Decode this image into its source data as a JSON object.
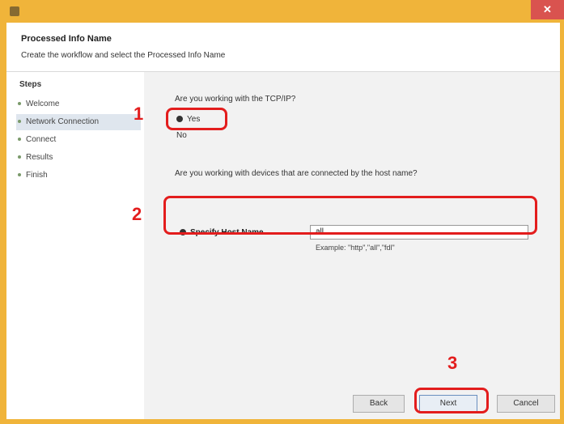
{
  "window": {
    "title": "",
    "close_label": "✕"
  },
  "header": {
    "title": "Processed Info Name",
    "description": "Create the workflow and select the Processed Info Name"
  },
  "sidebar": {
    "heading": "Steps",
    "items": [
      {
        "label": "Welcome"
      },
      {
        "label": "Network Connection"
      },
      {
        "label": "Connect"
      },
      {
        "label": "Results"
      },
      {
        "label": "Finish"
      }
    ]
  },
  "content": {
    "question1": "Are you working with the TCP/IP?",
    "radio_yes": "Yes",
    "radio_no": "No",
    "question2": "Are you working with devices that are connected by the host name?",
    "question2_sub": "",
    "host_label": "Specify Host Name",
    "host_value": "all",
    "host_example": "Example: \"http\",\"all\",\"fdl\""
  },
  "buttons": {
    "back": "Back",
    "next": "Next",
    "cancel": "Cancel"
  },
  "annotations": {
    "n1": "1",
    "n2": "2",
    "n3": "3"
  }
}
